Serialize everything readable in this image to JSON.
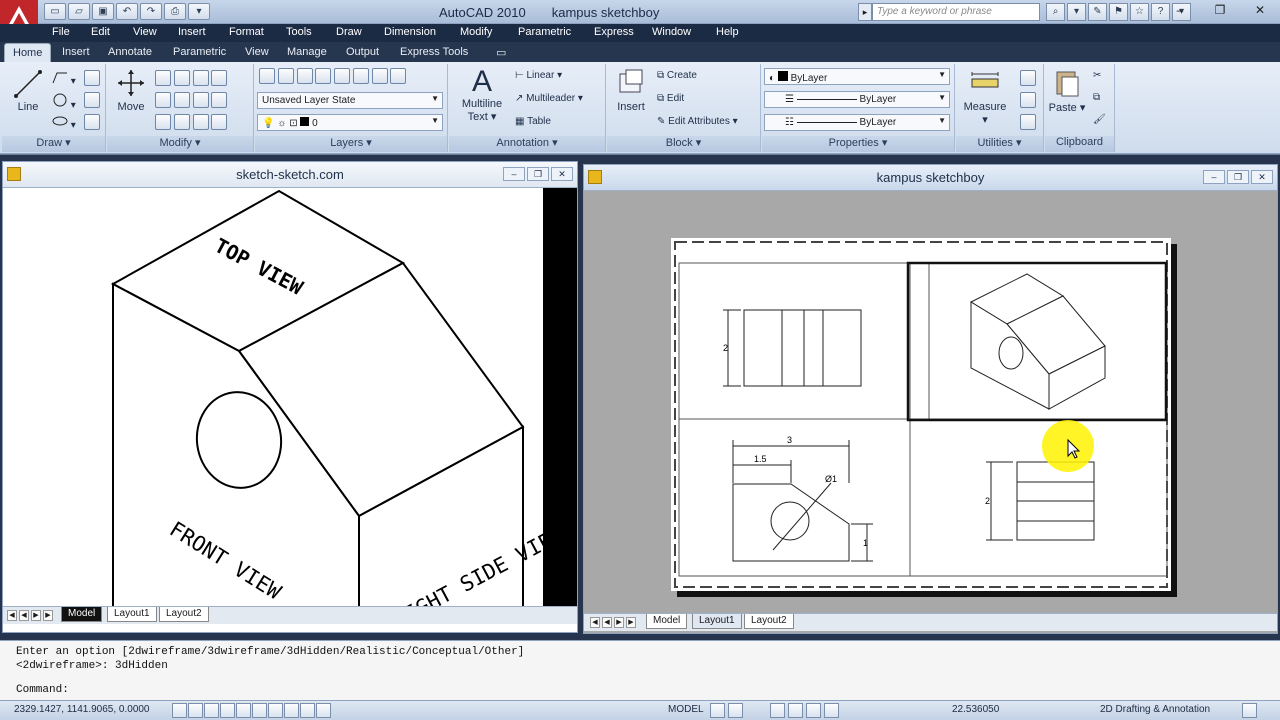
{
  "app": {
    "name": "AutoCAD 2010",
    "document": "kampus sketchboy"
  },
  "search": {
    "placeholder": "Type a keyword or phrase"
  },
  "menu": [
    "File",
    "Edit",
    "View",
    "Insert",
    "Format",
    "Tools",
    "Draw",
    "Dimension",
    "Modify",
    "Parametric",
    "Express",
    "Window",
    "Help"
  ],
  "ribbon_tabs": [
    "Home",
    "Insert",
    "Annotate",
    "Parametric",
    "View",
    "Manage",
    "Output",
    "Express Tools"
  ],
  "ribbon": {
    "draw": {
      "label": "Draw",
      "line": "Line"
    },
    "modify": {
      "label": "Modify",
      "move": "Move"
    },
    "layers": {
      "label": "Layers",
      "state": "Unsaved Layer State",
      "current": "0"
    },
    "annotation": {
      "label": "Annotation",
      "mtext_1": "Multiline",
      "mtext_2": "Text",
      "linear": "Linear",
      "multileader": "Multileader",
      "table": "Table"
    },
    "block": {
      "label": "Block",
      "insert": "Insert",
      "create": "Create",
      "edit": "Edit",
      "edit_attributes": "Edit Attributes"
    },
    "properties": {
      "label": "Properties",
      "color": "ByLayer",
      "linetype": "ByLayer",
      "lineweight": "ByLayer"
    },
    "utilities": {
      "label": "Utilities",
      "measure": "Measure"
    },
    "clipboard": {
      "label": "Clipboard",
      "paste": "Paste"
    }
  },
  "left_window": {
    "title": "sketch-sketch.com",
    "tabs": [
      "Model",
      "Layout1",
      "Layout2"
    ],
    "labels": {
      "top": "TOP VIEW",
      "front": "FRONT VIEW",
      "side": "RIGHT SIDE VIEW"
    }
  },
  "right_window": {
    "title": "kampus sketchboy",
    "tabs": [
      "Model",
      "Layout1",
      "Layout2"
    ],
    "dims": {
      "front_height": "2",
      "top_width": "3",
      "top_offset": "1.5",
      "hole": "Ø1",
      "top_step": "1",
      "side_height": "2"
    }
  },
  "command": {
    "line1": "Enter an option [2dwireframe/3dwireframe/3dHidden/Realistic/Conceptual/Other]",
    "line2": "<2dwireframe>: 3dHidden",
    "prompt": "Command:"
  },
  "status": {
    "coords": "2329.1427, 1141.9065, 0.0000",
    "space": "MODEL",
    "scale": "22.536050",
    "workspace": "2D Drafting & Annotation"
  }
}
